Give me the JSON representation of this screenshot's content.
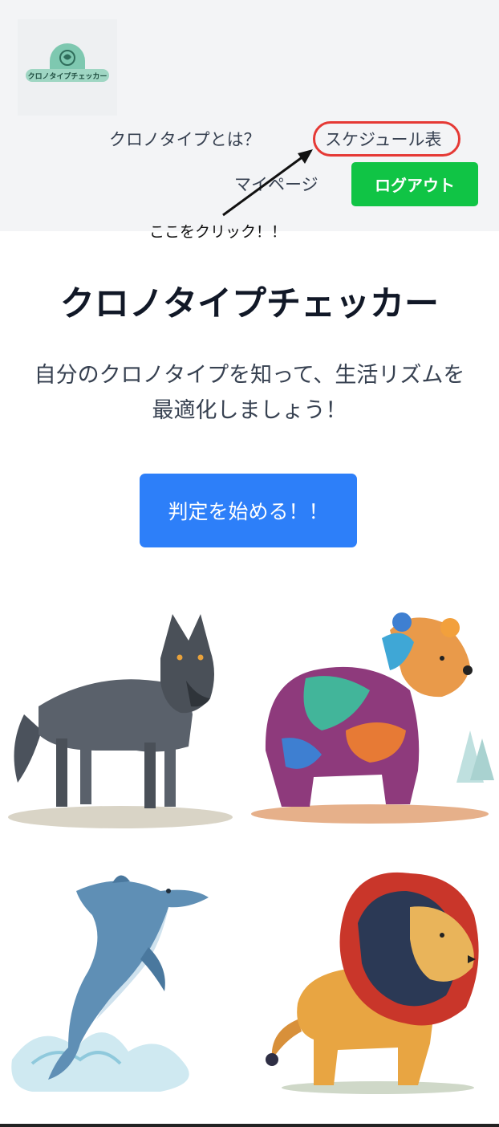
{
  "header": {
    "logo_text": "クロノタイプチェッカー",
    "nav": {
      "about": "クロノタイプとは？",
      "schedule": "スケジュール表",
      "mypage": "マイページ",
      "logout": "ログアウト"
    }
  },
  "annotation": {
    "note": "ここをクリック！！",
    "ring_color": "#e53935"
  },
  "main": {
    "title": "クロノタイプチェッカー",
    "subtitle": "自分のクロノタイプを知って、生活リズムを最適化しましょう！",
    "start_button": "判定を始める！！"
  },
  "animals": [
    "wolf-icon",
    "bear-icon",
    "dolphin-icon",
    "lion-icon"
  ],
  "colors": {
    "logout": "#10c445",
    "start": "#2d7ff9",
    "header_bg": "#f3f4f6"
  }
}
